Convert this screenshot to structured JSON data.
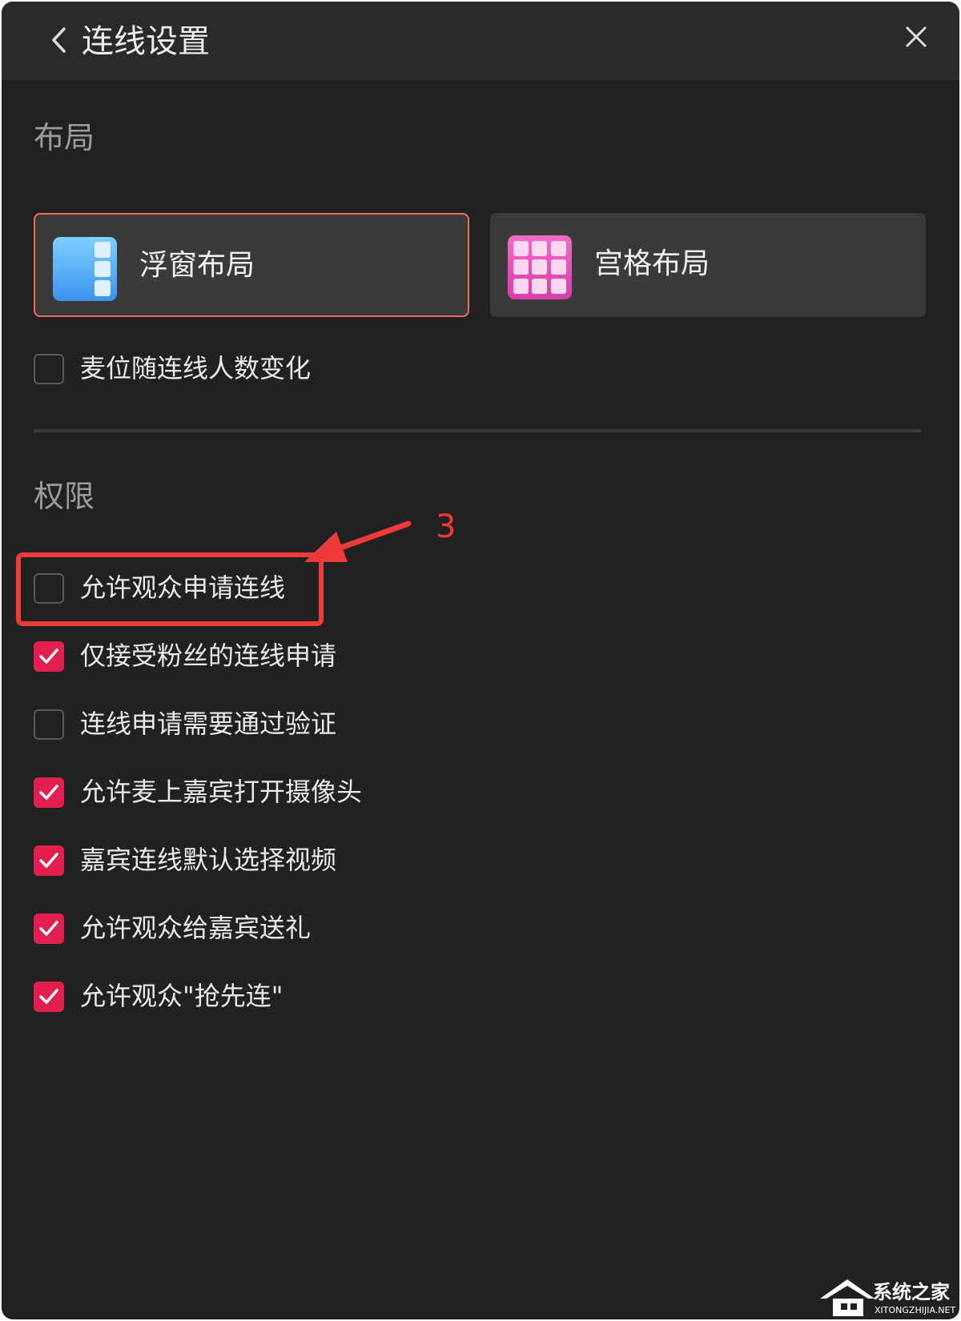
{
  "header": {
    "title": "连线设置"
  },
  "layout_section": {
    "title": "布局",
    "options": [
      {
        "label": "浮窗布局",
        "selected": true,
        "icon": "floating-window-icon"
      },
      {
        "label": "宫格布局",
        "selected": false,
        "icon": "grid-icon"
      }
    ],
    "seat_follow": {
      "label": "麦位随连线人数变化",
      "checked": false
    }
  },
  "permissions_section": {
    "title": "权限",
    "items": [
      {
        "label": "允许观众申请连线",
        "checked": false
      },
      {
        "label": "仅接受粉丝的连线申请",
        "checked": true
      },
      {
        "label": "连线申请需要通过验证",
        "checked": false
      },
      {
        "label": "允许麦上嘉宾打开摄像头",
        "checked": true
      },
      {
        "label": "嘉宾连线默认选择视频",
        "checked": true
      },
      {
        "label": "允许观众给嘉宾送礼",
        "checked": true
      },
      {
        "label": "允许观众\"抢先连\"",
        "checked": true
      }
    ]
  },
  "annotation": {
    "step_number": "3"
  },
  "watermark": {
    "text": "系统之家",
    "subtext": "XITONGZHIJIA.NET"
  },
  "colors": {
    "accent": "#e2204f",
    "annotation": "#ee3a38",
    "background": "#212121"
  }
}
